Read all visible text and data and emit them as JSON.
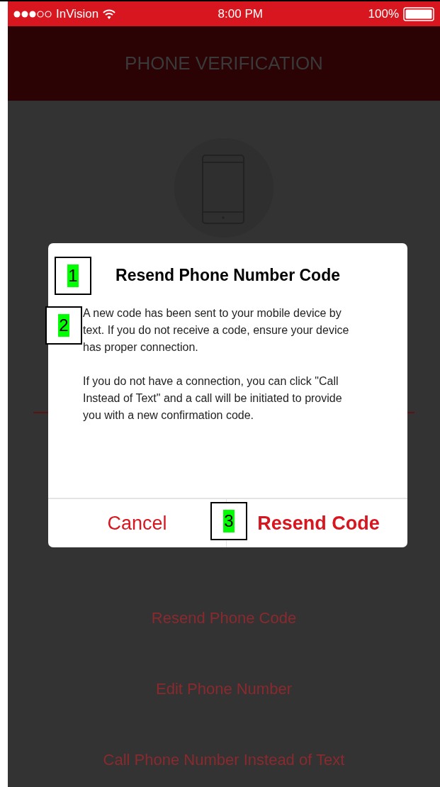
{
  "status_bar": {
    "carrier": "InVision",
    "time": "8:00 PM",
    "battery": "100%"
  },
  "header": {
    "title": "PHONE VERIFICATION"
  },
  "links": [
    {
      "label": "Resend Phone Code"
    },
    {
      "label": "Edit Phone Number"
    },
    {
      "label": "Call Phone Number Instead of Text"
    }
  ],
  "dialog": {
    "title": "Resend Phone Number Code",
    "paragraphs": [
      "A new code has been sent to your mobile device by text. If you do not receive a code, ensure your device has proper connection.",
      "If you do not have a connection, you can click \"Call Instead of Text\" and a call will be initiated to provide you with a new confirmation code."
    ],
    "buttons": [
      {
        "label": "Cancel",
        "primary": false
      },
      {
        "label": "Resend Code",
        "primary": true
      }
    ]
  },
  "annotations": [
    {
      "label": "1"
    },
    {
      "label": "2"
    },
    {
      "label": "3"
    }
  ]
}
